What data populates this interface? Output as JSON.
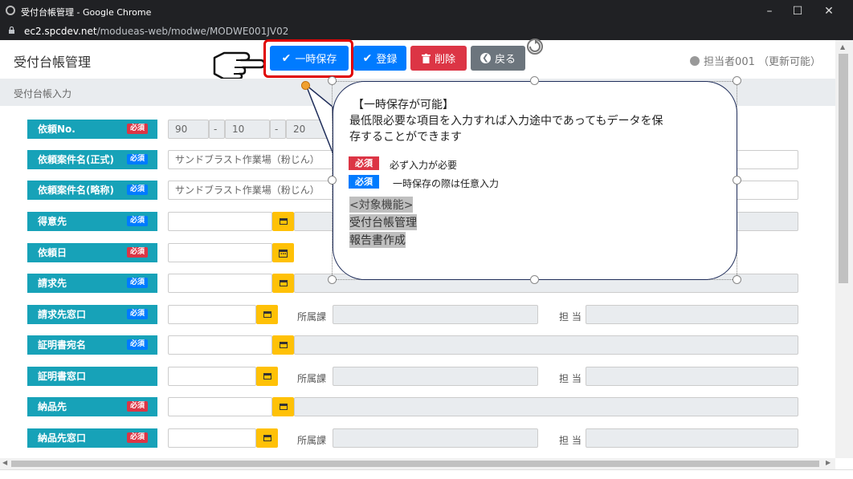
{
  "window": {
    "title": "受付台帳管理 - Google Chrome",
    "url_host": "ec2.spcdev.net",
    "url_path": "/modueas-web/modwe/MODWE001JV02"
  },
  "header": {
    "title": "受付台帳管理",
    "buttons": {
      "temp_save": "一時保存",
      "register": "登録",
      "delete": "削除",
      "back": "戻る"
    },
    "user": "担当者001 （更新可能）"
  },
  "section": {
    "title": "受付台帳入力"
  },
  "badges": {
    "required": "必須"
  },
  "form": {
    "rows": [
      {
        "label": "依頼No.",
        "badge": "red"
      },
      {
        "label": "依頼案件名(正式)",
        "badge": "blue"
      },
      {
        "label": "依頼案件名(略称)",
        "badge": "blue"
      },
      {
        "label": "得意先",
        "badge": "blue"
      },
      {
        "label": "依頼日",
        "badge": "red"
      },
      {
        "label": "請求先",
        "badge": "blue"
      },
      {
        "label": "請求先窓口",
        "badge": "blue"
      },
      {
        "label": "証明書宛名",
        "badge": "blue"
      },
      {
        "label": "証明書窓口",
        "badge": ""
      },
      {
        "label": "納品先",
        "badge": "red"
      },
      {
        "label": "納品先窓口",
        "badge": "red"
      }
    ],
    "request_no": {
      "part1": "90",
      "sep1": "-",
      "part2": "10",
      "sep2": "-",
      "part3": "20"
    },
    "case_name_formal": "サンドブラスト作業場（粉じん）",
    "case_name_short": "サンドブラスト作業場（粉じん）",
    "dept_label": "所属課",
    "person_label": "担 当"
  },
  "callout": {
    "heading": "【一時保存が可能】",
    "line1": "最低限必要な項目を入力すれば入力途中であってもデータを保",
    "line2": "存することができます",
    "legend_red_text": "必ず入力が必要",
    "legend_blue_text": "一時保存の際は任意入力",
    "targets_heading": "<対象機能>",
    "target1": "受付台帳管理",
    "target2": "報告書作成"
  },
  "colors": {
    "primary": "#007bff",
    "danger": "#dc3545",
    "secondary": "#6c757d",
    "info": "#17a2b8",
    "warning": "#ffc107",
    "highlight_red": "#e00000"
  },
  "icons": [
    "check-icon",
    "trash-icon",
    "back-arrow-icon",
    "user-icon",
    "calendar-icon",
    "window-icon",
    "pointing-hand-icon",
    "rotate-icon"
  ]
}
